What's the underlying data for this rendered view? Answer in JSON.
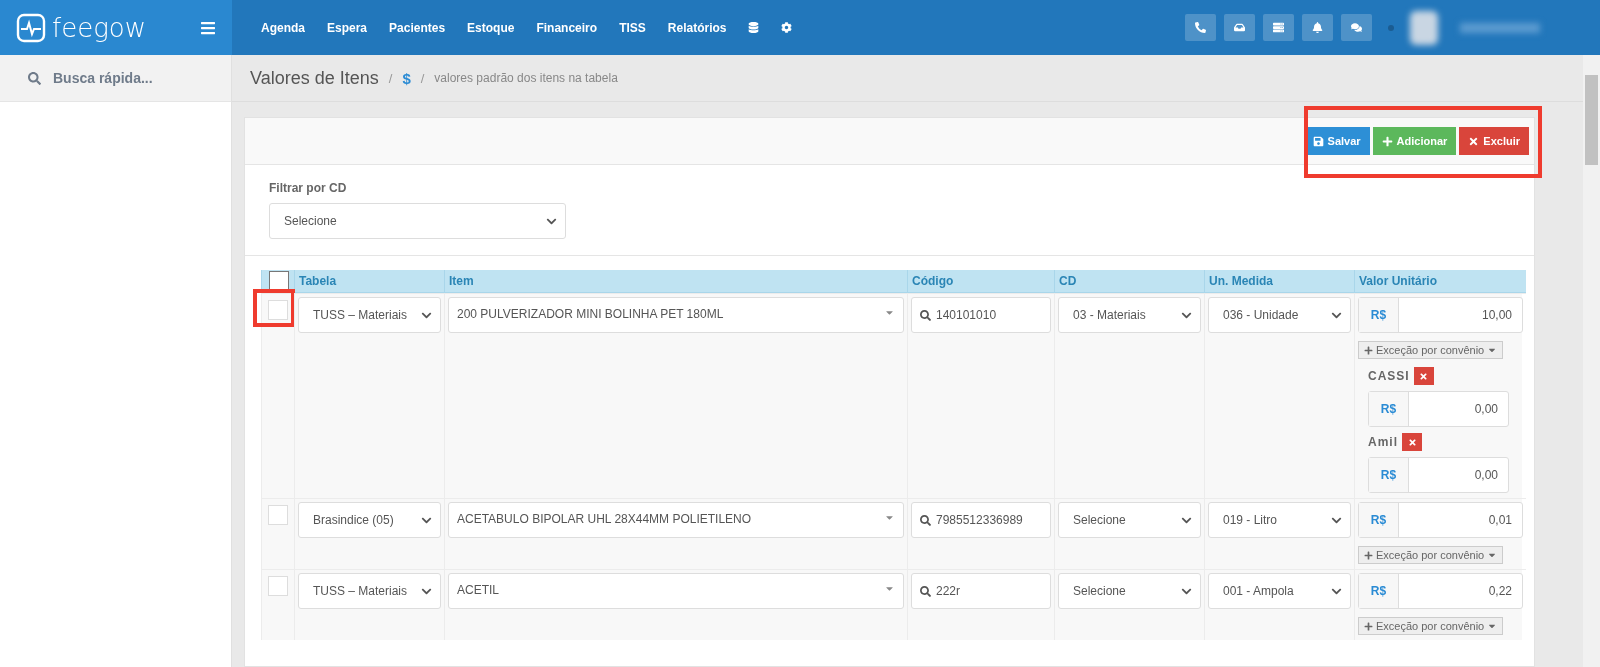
{
  "brand": {
    "name": "feegow"
  },
  "nav": {
    "items": [
      "Agenda",
      "Espera",
      "Pacientes",
      "Estoque",
      "Financeiro",
      "TISS",
      "Relatórios"
    ]
  },
  "sidebar": {
    "search_placeholder": "Busca rápida..."
  },
  "breadcrumb": {
    "title": "Valores de Itens",
    "separator": "/",
    "icon": "$",
    "subtitle": "valores padrão dos itens na tabela"
  },
  "toolbar": {
    "buttons": [
      {
        "kind": "save",
        "label": "Salvar"
      },
      {
        "kind": "add",
        "label": "Adicionar"
      },
      {
        "kind": "delete",
        "label": "Excluir"
      }
    ]
  },
  "filter": {
    "label": "Filtrar por CD",
    "value": "Selecione"
  },
  "table": {
    "select_all_checked": false,
    "columns": [
      "Tabela",
      "Item",
      "Código",
      "CD",
      "Un. Medida",
      "Valor Unitário"
    ],
    "rows": [
      {
        "checked": false,
        "tabela": "TUSS – Materiais",
        "item": "200 PULVERIZADOR MINI BOLINHA PET 180ML",
        "codigo": "140101010",
        "cd": "03 - Materiais",
        "unidade": "036 - Unidade",
        "currency": "R$",
        "valor": "10,00",
        "exception_button": "Exceção por convênio",
        "exceptions": [
          {
            "name": "CASSI",
            "currency": "R$",
            "valor": "0,00"
          },
          {
            "name": "Amil",
            "currency": "R$",
            "valor": "0,00"
          }
        ]
      },
      {
        "checked": false,
        "tabela": "Brasindice (05)",
        "item": "ACETABULO BIPOLAR UHL 28X44MM POLIETILENO",
        "codigo": "7985512336989",
        "cd": "Selecione",
        "unidade": "019 - Litro",
        "currency": "R$",
        "valor": "0,01",
        "exception_button": "Exceção por convênio",
        "exceptions": []
      },
      {
        "checked": false,
        "tabela": "TUSS – Materiais",
        "item": "ACETIL",
        "codigo": "222r",
        "cd": "Selecione",
        "unidade": "001 - Ampola",
        "currency": "R$",
        "valor": "0,22",
        "exception_button": "Exceção por convênio",
        "exceptions": []
      }
    ]
  }
}
